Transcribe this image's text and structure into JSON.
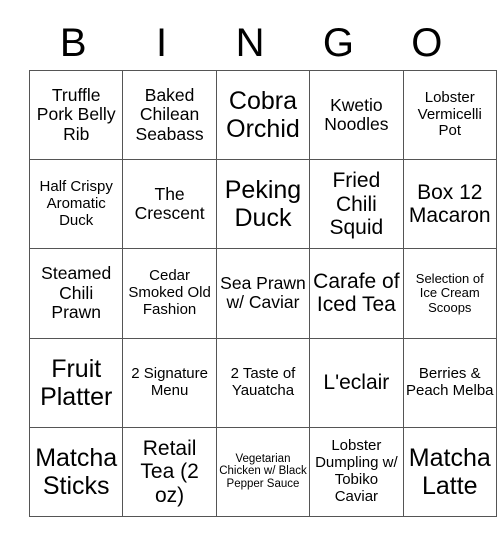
{
  "card": {
    "header_letters": [
      "B",
      "I",
      "N",
      "G",
      "O"
    ],
    "columns": 5,
    "rows": 5,
    "border_color": "#555555",
    "text_color": "#000000",
    "background_color": "#ffffff",
    "cells": [
      [
        "Truffle Pork Belly Rib",
        "Baked Chilean Seabass",
        "Cobra Orchid",
        "Kwetio Noodles",
        "Lobster Vermicelli Pot"
      ],
      [
        "Half Crispy Aromatic Duck",
        "The Crescent",
        "Peking Duck",
        "Fried Chili Squid",
        "Box 12 Macaron"
      ],
      [
        "Steamed Chili Prawn",
        "Cedar Smoked Old Fashion",
        "Sea Prawn w/ Caviar",
        "Carafe of Iced Tea",
        "Selection of Ice Cream Scoops"
      ],
      [
        "Fruit Platter",
        "2 Signature Menu",
        "2 Taste of Yauatcha",
        "L'eclair",
        "Berries & Peach Melba"
      ],
      [
        "Matcha Sticks",
        "Retail Tea (2 oz)",
        "Vegetarian Chicken w/ Black Pepper Sauce",
        "Lobster Dumpling w/ Tobiko Caviar",
        "Matcha Latte"
      ]
    ],
    "cell_sizes": [
      [
        "md",
        "md",
        "xl",
        "md",
        "sm"
      ],
      [
        "sm",
        "md",
        "xl",
        "lg",
        "lg"
      ],
      [
        "md",
        "sm",
        "md",
        "lg",
        "xs"
      ],
      [
        "xl",
        "sm",
        "sm",
        "lg",
        "sm"
      ],
      [
        "xl",
        "lg",
        "xxs",
        "sm",
        "xl"
      ]
    ]
  }
}
